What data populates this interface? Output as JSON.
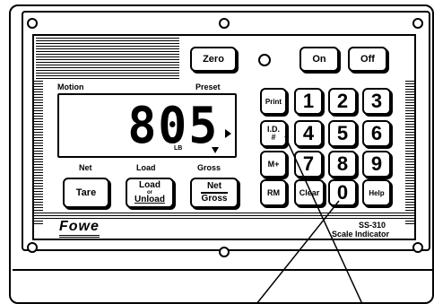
{
  "display": {
    "reading": "805",
    "unit": "LB",
    "left_label": "Motion",
    "right_label": "Preset"
  },
  "keys": {
    "zero": "Zero",
    "on": "On",
    "off": "Off",
    "print": "Print",
    "id": "I.D.",
    "id_sub": "#",
    "mplus": "M+",
    "rm": "RM",
    "clear": "Clear",
    "help": "Help",
    "n1": "1",
    "n2": "2",
    "n3": "3",
    "n4": "4",
    "n5": "5",
    "n6": "6",
    "n7": "7",
    "n8": "8",
    "n9": "9",
    "n0": "0",
    "tare": "Tare",
    "load_top": "Load",
    "load_or": "or",
    "load_bottom": "Unload",
    "net": "Net",
    "gross": "Gross"
  },
  "labels": {
    "net": "Net",
    "load": "Load",
    "gross": "Gross"
  },
  "branding": {
    "logo": "Fowe",
    "model": "SS-310",
    "product": "Scale Indicator"
  }
}
